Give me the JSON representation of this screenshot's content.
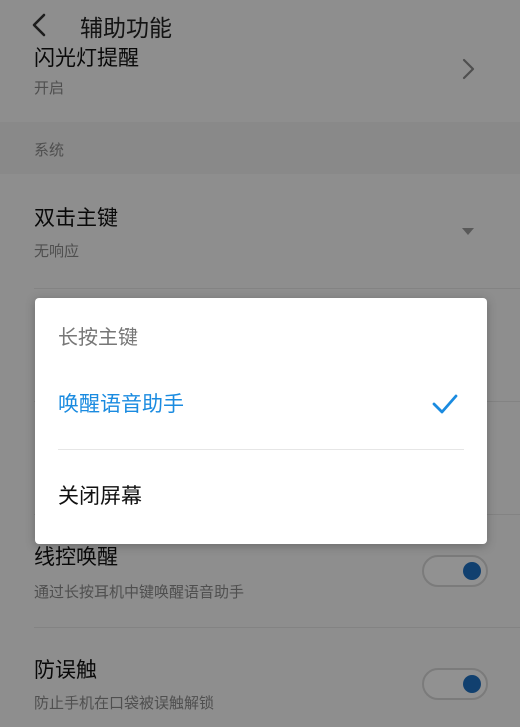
{
  "header": {
    "title": "辅助功能"
  },
  "rows": {
    "cut_row_title": "闪光灯提醒",
    "cut_row_value": "开启",
    "section_label": "系统",
    "double_tap_title": "双击主键",
    "double_tap_value": "无响应",
    "wire_title": "线控唤醒",
    "wire_desc": "通过长按耳机中键唤醒语音助手",
    "wire_on": true,
    "antitouch_title": "防误触",
    "antitouch_desc": "防止手机在口袋被误触解锁",
    "antitouch_on": true
  },
  "dialog": {
    "title": "长按主键",
    "options": [
      {
        "label": "唤醒语音助手",
        "selected": true
      },
      {
        "label": "关闭屏幕",
        "selected": false
      }
    ]
  },
  "colors": {
    "accent": "#1a8be0",
    "toggle_knob": "#1e6fc0"
  },
  "icons": {
    "back": "back-arrow-icon",
    "chevron": "chevron-right-icon",
    "dropdown": "dropdown-arrow-icon",
    "check": "check-icon"
  }
}
